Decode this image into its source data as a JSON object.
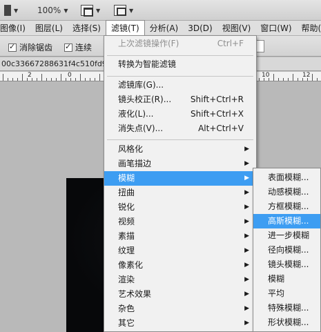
{
  "appbar": {
    "zoom": "100%"
  },
  "menubar": {
    "items": [
      {
        "label": "图像(I)"
      },
      {
        "label": "图层(L)"
      },
      {
        "label": "选择(S)"
      },
      {
        "label": "滤镜(T)"
      },
      {
        "label": "分析(A)"
      },
      {
        "label": "3D(D)"
      },
      {
        "label": "视图(V)"
      },
      {
        "label": "窗口(W)"
      },
      {
        "label": "帮助(H)"
      }
    ]
  },
  "options": {
    "antialias_label": "消除锯齿",
    "contiguous_label": "连续"
  },
  "document": {
    "tab_text": "00c33667288631f4c510fd9"
  },
  "ruler": {
    "labels": [
      "2",
      "0",
      "10",
      "12"
    ]
  },
  "filter_menu": {
    "last_filter": {
      "label": "上次滤镜操作(F)",
      "shortcut": "Ctrl+F"
    },
    "smart_filters": "转换为智能滤镜",
    "filter_gallery": "滤镜库(G)...",
    "lens_correction": {
      "label": "镜头校正(R)...",
      "shortcut": "Shift+Ctrl+R"
    },
    "liquify": {
      "label": "液化(L)...",
      "shortcut": "Shift+Ctrl+X"
    },
    "vanishing_point": {
      "label": "消失点(V)...",
      "shortcut": "Alt+Ctrl+V"
    },
    "groups": [
      "风格化",
      "画笔描边",
      "模糊",
      "扭曲",
      "锐化",
      "视频",
      "素描",
      "纹理",
      "像素化",
      "渲染",
      "艺术效果",
      "杂色",
      "其它"
    ]
  },
  "blur_submenu": {
    "items": [
      "表面模糊...",
      "动感模糊...",
      "方框模糊...",
      "高斯模糊...",
      "进一步模糊",
      "径向模糊...",
      "镜头模糊...",
      "模糊",
      "平均",
      "特殊模糊...",
      "形状模糊..."
    ]
  },
  "colors": {
    "highlight": "#3d9df2",
    "menu_bg": "#f1f1f1"
  }
}
